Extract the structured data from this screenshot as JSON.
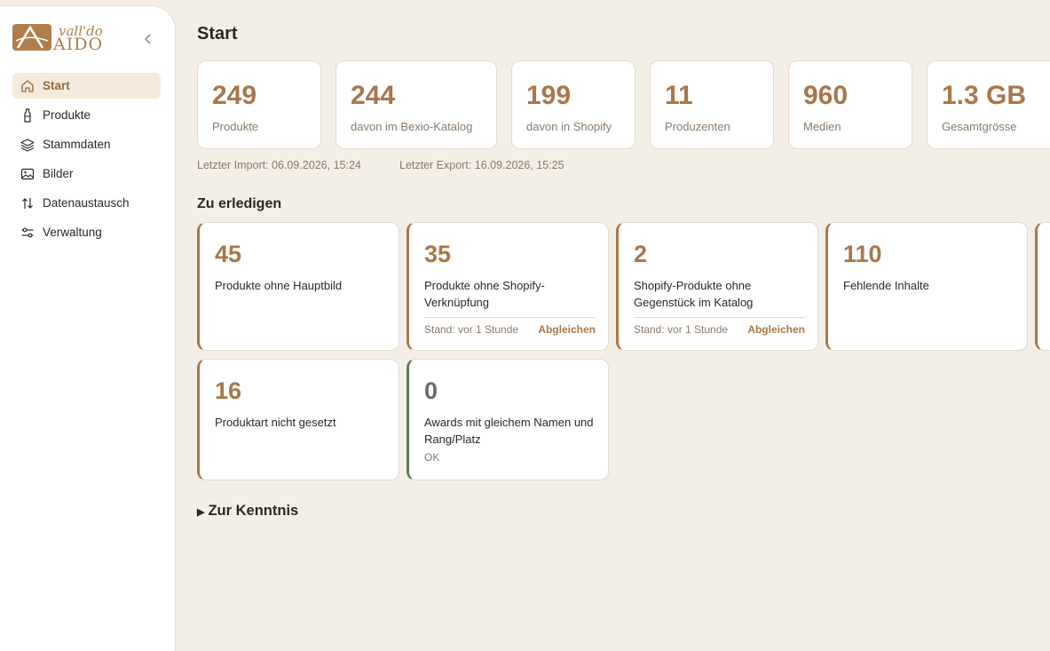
{
  "brand": {
    "line1": "vall'do",
    "line2": "AIDO",
    "color": "#b07d4c"
  },
  "sidebar": {
    "items": [
      {
        "label": "Start",
        "icon": "home-icon",
        "active": true
      },
      {
        "label": "Produkte",
        "icon": "bottle-icon"
      },
      {
        "label": "Stammdaten",
        "icon": "layers-icon"
      },
      {
        "label": "Bilder",
        "icon": "image-icon"
      },
      {
        "label": "Datenaustausch",
        "icon": "arrows-icon"
      },
      {
        "label": "Verwaltung",
        "icon": "sliders-icon"
      }
    ]
  },
  "page": {
    "title": "Start"
  },
  "stats": [
    {
      "value": "249",
      "label": "Produkte"
    },
    {
      "value": "244",
      "label": "davon im Bexio-Katalog"
    },
    {
      "value": "199",
      "label": "davon in Shopify"
    },
    {
      "value": "11",
      "label": "Produzenten"
    },
    {
      "value": "960",
      "label": "Medien"
    },
    {
      "value": "1.3 GB",
      "label": "Gesamtgrösse"
    }
  ],
  "meta": {
    "last_import": "Letzter Import: 06.09.2026, 15:24",
    "last_export": "Letzter Export: 16.09.2026, 15:25"
  },
  "todo": {
    "title": "Zu erledigen",
    "cards": [
      {
        "value": "45",
        "label": "Produkte ohne Hauptbild"
      },
      {
        "value": "35",
        "label": "Produkte ohne Shopify-Verknüpfung",
        "stand": "Stand: vor 1 Stunde",
        "action": "Abgleichen"
      },
      {
        "value": "2",
        "label": "Shopify-Produkte ohne Gegenstück im Katalog",
        "stand": "Stand: vor 1 Stunde",
        "action": "Abgleichen"
      },
      {
        "value": "110",
        "label": "Fehlende Inhalte"
      },
      {
        "value": "16",
        "label": "Produktart nicht gesetzt"
      },
      {
        "value": "0",
        "label": "Awards mit gleichem Namen und Rang/Platz",
        "status": "OK"
      }
    ]
  },
  "kenntnis": {
    "label": "Zur Kenntnis"
  },
  "colors": {
    "accent": "#a8774a",
    "ok": "#5a7d4e",
    "background": "#f4efe6"
  }
}
